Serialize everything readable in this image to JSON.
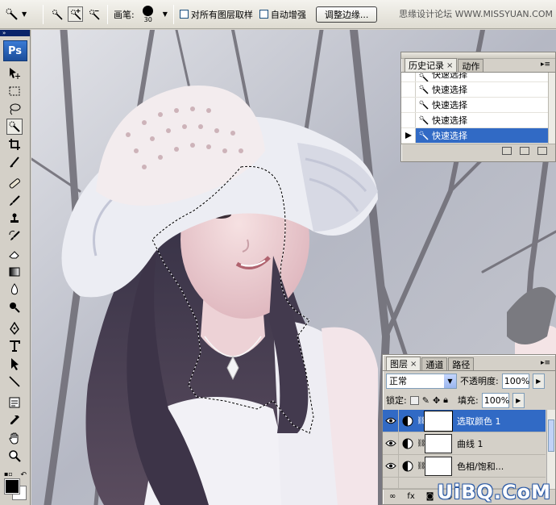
{
  "options_bar": {
    "brush_label": "画笔:",
    "brush_size": "30",
    "sample_all_layers_label": "对所有图层取样",
    "auto_enhance_label": "自动增强",
    "refine_edge_label": "调整边缘..."
  },
  "watermark_top": "思缘设计论坛 WWW.MISSYUAN.COM",
  "toolbox": {
    "logo": "Ps"
  },
  "history_panel": {
    "tabs": [
      {
        "label": "历史记录",
        "active": true
      },
      {
        "label": "动作",
        "active": false
      }
    ],
    "items": [
      {
        "label": "快速选择",
        "selected": false
      },
      {
        "label": "快速选择",
        "selected": false
      },
      {
        "label": "快速选择",
        "selected": false
      },
      {
        "label": "快速选择",
        "selected": false
      },
      {
        "label": "快速选择",
        "selected": true
      }
    ]
  },
  "layers_panel": {
    "tabs": [
      {
        "label": "图层",
        "active": true
      },
      {
        "label": "通道",
        "active": false
      },
      {
        "label": "路径",
        "active": false
      }
    ],
    "blend_mode": "正常",
    "opacity_label": "不透明度:",
    "opacity_value": "100%",
    "lock_label": "锁定:",
    "fill_label": "填充:",
    "fill_value": "100%",
    "layers": [
      {
        "name": "选取颜色 1",
        "selected": true
      },
      {
        "name": "曲线 1",
        "selected": false
      },
      {
        "name": "色相/饱和...",
        "selected": false
      }
    ]
  },
  "site_watermark": "UiBQ.CoM",
  "colors": {
    "selection_blue": "#316ac5",
    "foreground": "#000000",
    "background": "#ffffff"
  }
}
